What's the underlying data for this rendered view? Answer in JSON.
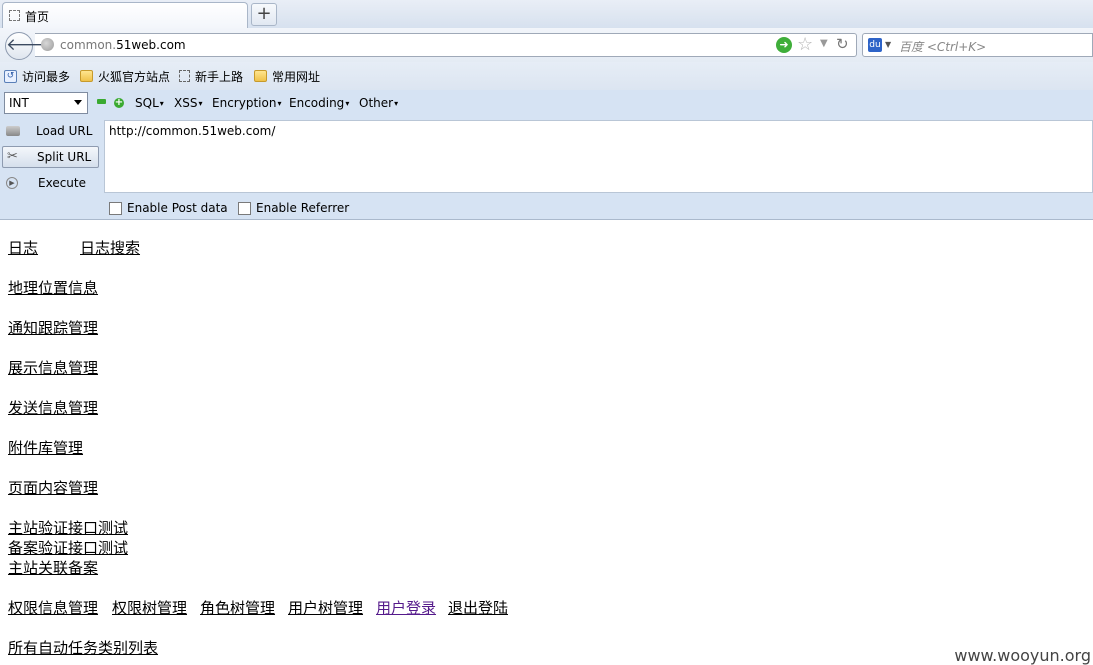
{
  "browser": {
    "tab_title": "首页",
    "new_tab_label": "+",
    "url_host_prefix": "common.",
    "url_host_domain": "51web.com",
    "search_placeholder": "百度 <Ctrl+K>",
    "icons": [
      "page-icon",
      "back-arrow-icon",
      "globe-icon",
      "go-arrow-icon",
      "star-icon",
      "dropdown-icon",
      "reload-icon",
      "baidu-icon"
    ]
  },
  "bookmarks": [
    {
      "label": "访问最多",
      "icon": "most-visited-icon"
    },
    {
      "label": "火狐官方站点",
      "icon": "folder-icon"
    },
    {
      "label": "新手上路",
      "icon": "page-icon"
    },
    {
      "label": "常用网址",
      "icon": "folder-icon"
    }
  ],
  "hackbar": {
    "select_value": "INT",
    "menus": [
      "SQL",
      "XSS",
      "Encryption",
      "Encoding",
      "Other"
    ],
    "buttons": {
      "load": "Load URL",
      "split": "Split URL",
      "execute": "Execute"
    },
    "url_value": "http://common.51web.com/",
    "post_label": "Enable Post data",
    "referrer_label": "Enable Referrer"
  },
  "content": {
    "links": {
      "log": "日志",
      "log_search": "日志搜索",
      "geo": "地理位置信息",
      "notify": "通知跟踪管理",
      "display": "展示信息管理",
      "send": "发送信息管理",
      "attach": "附件库管理",
      "page": "页面内容管理",
      "main_verify": "主站验证接口测试",
      "record_verify": "备案验证接口测试",
      "main_link": "主站关联备案",
      "perm_info": "权限信息管理",
      "perm_tree": "权限树管理",
      "role_tree": "角色树管理",
      "user_tree": "用户树管理",
      "user_login": "用户登录",
      "logout": "退出登陆",
      "tasks": "所有自动任务类别列表"
    }
  },
  "watermark": "www.wooyun.org",
  "colors": {
    "visited_link": "#551a8b",
    "hackbar_bg": "#d6e3f3"
  }
}
